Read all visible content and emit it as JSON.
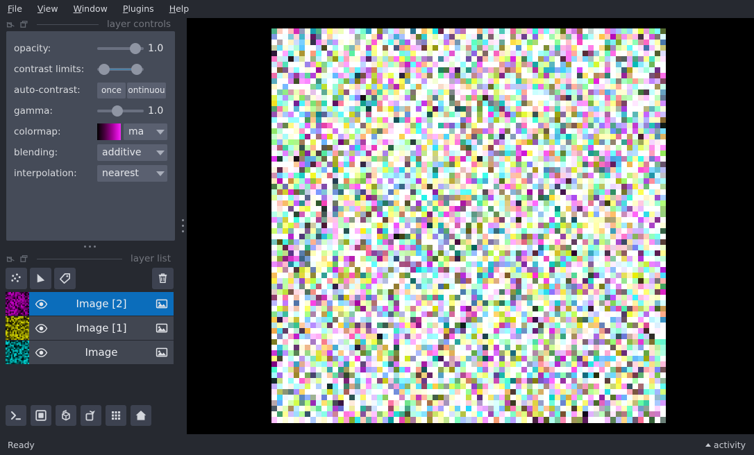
{
  "window": {
    "title": "napari",
    "background": "#262930",
    "accent": "#0b6dbb"
  },
  "menubar": {
    "items": [
      {
        "label": "File",
        "mnemonic": "F"
      },
      {
        "label": "View",
        "mnemonic": "V"
      },
      {
        "label": "Window",
        "mnemonic": "W"
      },
      {
        "label": "Plugins",
        "mnemonic": "P"
      },
      {
        "label": "Help",
        "mnemonic": "H"
      }
    ]
  },
  "layer_controls": {
    "dock_title": "layer controls",
    "float_icon": "undock-icon",
    "close_icon": "close-icon",
    "rows": {
      "opacity": {
        "label": "opacity:",
        "value": "1.0",
        "slider_percent": 92
      },
      "contrast_limits": {
        "label": "contrast limits:",
        "low_percent": 3,
        "high_percent": 97
      },
      "auto_contrast": {
        "label": "auto-contrast:",
        "once_label": "once",
        "continuous_label": "ontinuou"
      },
      "gamma": {
        "label": "gamma:",
        "value": "1.0",
        "slider_percent": 42
      },
      "colormap": {
        "label": "colormap:",
        "value": "ma",
        "swatch_colors": [
          "#000000",
          "#9c0090",
          "#ee2ef0"
        ]
      },
      "blending": {
        "label": "blending:",
        "value": "additive"
      },
      "interpolation": {
        "label": "interpolation:",
        "value": "nearest"
      }
    }
  },
  "layer_list": {
    "dock_title": "layer list",
    "float_icon": "undock-icon",
    "close_icon": "close-icon",
    "toolbar": [
      {
        "name": "new-points-button",
        "icon": "points-icon"
      },
      {
        "name": "new-shapes-button",
        "icon": "shapes-icon"
      },
      {
        "name": "new-labels-button",
        "icon": "labels-icon"
      }
    ],
    "delete_button": {
      "name": "delete-layer-button",
      "icon": "trash-icon"
    },
    "layers": [
      {
        "name": "Image [2]",
        "selected": true,
        "visible": true,
        "type_icon": "image-icon",
        "thumbnail_color": "#d400d4",
        "thumbnail_seed": 7
      },
      {
        "name": "Image [1]",
        "selected": false,
        "visible": true,
        "type_icon": "image-icon",
        "thumbnail_color": "#e8e800",
        "thumbnail_seed": 23
      },
      {
        "name": "Image",
        "selected": false,
        "visible": true,
        "type_icon": "image-icon",
        "thumbnail_color": "#00dede",
        "thumbnail_seed": 41
      }
    ]
  },
  "viewer_buttons": [
    {
      "name": "console-button",
      "icon": "console-icon"
    },
    {
      "name": "ndisplay-toggle-button",
      "icon": "square-2d-icon"
    },
    {
      "name": "roll-dims-button",
      "icon": "cube-roll-icon"
    },
    {
      "name": "transpose-dims-button",
      "icon": "transpose-icon"
    },
    {
      "name": "grid-view-button",
      "icon": "grid-icon"
    },
    {
      "name": "reset-view-button",
      "icon": "home-icon"
    }
  ],
  "canvas": {
    "background": "#000000",
    "image": {
      "blending": "additive",
      "pixel_size": 8,
      "grid_cols": 71,
      "grid_rows": 71,
      "channel_colors": [
        "#d400d4",
        "#e8e800",
        "#00dede"
      ]
    }
  },
  "statusbar": {
    "status": "Ready",
    "activity_label": "activity",
    "activity_icon": "caret-up-icon"
  }
}
